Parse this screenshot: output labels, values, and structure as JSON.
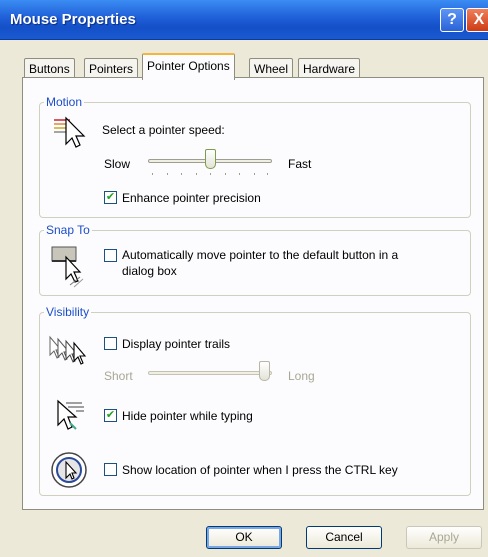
{
  "window": {
    "title": "Mouse Properties",
    "help_label": "?",
    "close_label": "X"
  },
  "tabs": [
    {
      "label": "Buttons"
    },
    {
      "label": "Pointers"
    },
    {
      "label": "Pointer Options"
    },
    {
      "label": "Wheel"
    },
    {
      "label": "Hardware"
    }
  ],
  "motion": {
    "legend": "Motion",
    "speed_label": "Select a pointer speed:",
    "slow_label": "Slow",
    "fast_label": "Fast",
    "speed_level": 0.5,
    "precision_label": "Enhance pointer precision",
    "precision_checked": true
  },
  "snap_to": {
    "legend": "Snap To",
    "auto_label_line1": "Automatically move pointer to the default button in a",
    "auto_label_line2": "dialog box",
    "auto_checked": false
  },
  "visibility": {
    "legend": "Visibility",
    "trails_label": "Display pointer trails",
    "trails_checked": false,
    "short_label": "Short",
    "long_label": "Long",
    "trail_level": 1.0,
    "hide_label": "Hide pointer while typing",
    "hide_checked": true,
    "ctrl_label": "Show location of pointer when I press the CTRL key",
    "ctrl_checked": false
  },
  "buttons": {
    "ok": "OK",
    "cancel": "Cancel",
    "apply": "Apply"
  },
  "colors": {
    "title_bar": "#1f5fd8",
    "legend": "#1c4ec8",
    "check": "#21a121"
  },
  "icons": [
    "pointer-speed-icon",
    "snap-to-icon",
    "pointer-trails-icon",
    "hide-pointer-icon",
    "locate-pointer-icon"
  ]
}
